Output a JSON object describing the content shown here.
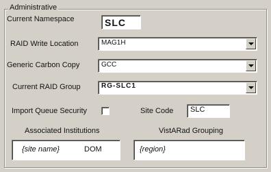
{
  "group": {
    "title": "Administrative"
  },
  "current_namespace": {
    "label": "Current Namespace",
    "value": "SLC"
  },
  "raid_write_location": {
    "label": "RAID Write Location",
    "value": "MAG1H"
  },
  "generic_carbon_copy": {
    "label": "Generic Carbon Copy",
    "value": "GCC"
  },
  "current_raid_group": {
    "label": "Current RAID Group",
    "value": "RG-SLC1"
  },
  "import_queue_security": {
    "label": "Import Queue Security",
    "checked": false
  },
  "site_code": {
    "label": "Site Code",
    "value": "SLC"
  },
  "associated_institutions": {
    "label": "Associated Institutions",
    "items": [
      {
        "name": "{site name}",
        "code": "DOM"
      }
    ]
  },
  "vistarad_grouping": {
    "label": "VistARad Grouping",
    "items": [
      "{region}"
    ]
  },
  "colors": {
    "panel": "#d4d0c8",
    "field": "#ffffff"
  },
  "icons": {
    "dropdown": "chevron-down-icon"
  }
}
